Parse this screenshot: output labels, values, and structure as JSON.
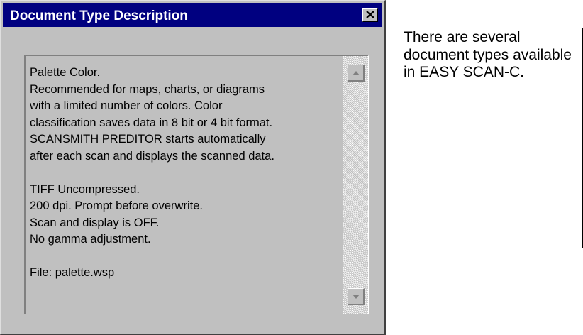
{
  "dialog": {
    "title": "Document Type Description",
    "close_icon": "close-icon",
    "description_lines": [
      "Palette Color.",
      "Recommended for maps, charts, or diagrams",
      "with a limited number of colors.  Color",
      "classification saves data in 8 bit or 4 bit format.",
      "SCANSMITH PREDITOR starts automatically",
      "after each scan and displays the scanned data.",
      "",
      "TIFF Uncompressed.",
      "200 dpi.  Prompt before overwrite.",
      "Scan and display is OFF.",
      "No gamma adjustment.",
      "",
      "File: palette.wsp"
    ],
    "scroll_up_icon": "arrow-up-icon",
    "scroll_down_icon": "arrow-down-icon"
  },
  "note": {
    "text": "There are several document types available in EASY SCAN-C."
  },
  "colors": {
    "title_bar": "#000080",
    "window_face": "#c0c0c0",
    "text": "#000000"
  }
}
